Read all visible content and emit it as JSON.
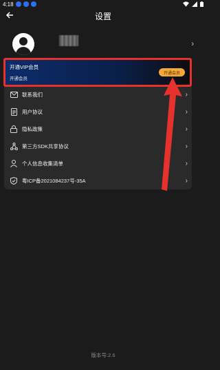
{
  "status_bar": {
    "time": "4:18"
  },
  "header": {
    "title": "设置"
  },
  "profile": {},
  "vip": {
    "title": "开通VIP会员",
    "subtitle": "开通会员",
    "button": "开通会员"
  },
  "menu": {
    "items": [
      {
        "label": "联系我们",
        "icon": "mail-icon"
      },
      {
        "label": "用户协议",
        "icon": "document-icon"
      },
      {
        "label": "隐私政策",
        "icon": "lock-icon"
      },
      {
        "label": "第三方SDK共享协议",
        "icon": "share-icon"
      },
      {
        "label": "个人信息收集清单",
        "icon": "user-icon"
      },
      {
        "label": "粤ICP备2021084237号-35A",
        "icon": "shield-check-icon"
      }
    ]
  },
  "footer": {
    "version": "版本号:2.6"
  },
  "colors": {
    "accent_red": "#e5322d",
    "vip_button": "#f3a83a",
    "background": "#1b1b1b",
    "card": "#2a2a2a"
  }
}
